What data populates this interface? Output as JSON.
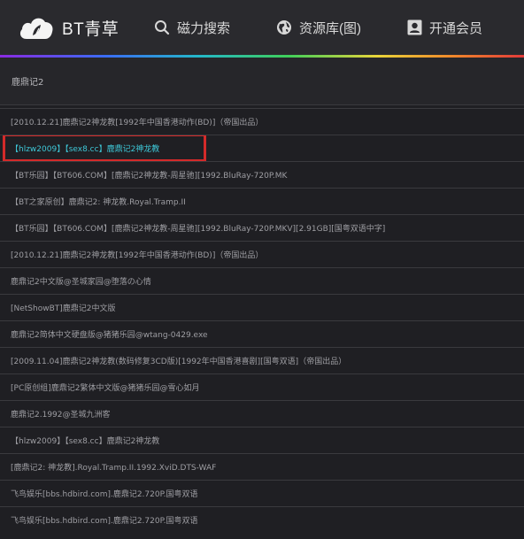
{
  "header": {
    "logo_text": "BT青草",
    "nav": [
      {
        "label": "磁力搜索",
        "icon": "search-icon"
      },
      {
        "label": "资源库(图)",
        "icon": "globe-icon"
      },
      {
        "label": "开通会员",
        "icon": "user-card-icon"
      }
    ]
  },
  "search": {
    "query": "鹿鼎记2"
  },
  "results": [
    "[2010.12.21]鹿鼎记2神龙教[1992年中国香港动作(BD)]（帝国出品）",
    "【hlzw2009】【sex8.cc】鹿鼎记2神龙教",
    "【BT乐园】【BT606.COM】[鹿鼎记2神龙教-周星驰][1992.BluRay-720P.MK",
    "【BT之家原创】鹿鼎记2: 神龙教.Royal.Tramp.II",
    "【BT乐园】【BT606.COM】[鹿鼎记2神龙教-周星驰][1992.BluRay-720P.MKV][2.91GB][国粤双语中字]",
    "[2010.12.21]鹿鼎记2神龙教[1992年中国香港动作(BD)]（帝国出品）",
    "鹿鼎记2中文版@圣城家园@堕落の心情",
    "[NetShowBT]鹿鼎记2中文版",
    "鹿鼎记2简体中文硬盘版@猪猪乐园@wtang-0429.exe",
    "[2009.11.04]鹿鼎记2神龙教(数码修复3CD版)[1992年中国香港喜剧][国粤双语]（帝国出品）",
    "[PC原创组]鹿鼎记2繁体中文版@猪猪乐园@雪心如月",
    "鹿鼎记2.1992@圣城九洲客",
    "【hlzw2009】【sex8.cc】鹿鼎记2神龙教",
    "[鹿鼎记2: 神龙教].Royal.Tramp.II.1992.XviD.DTS-WAF",
    "飞鸟娱乐[bbs.hdbird.com].鹿鼎记2.720P.国粤双语",
    "飞鸟娱乐[bbs.hdbird.com].鹿鼎记2.720P.国粤双语"
  ],
  "colors": {
    "highlight_text": "#3ec8d8",
    "highlight_box": "#d42a2a"
  }
}
